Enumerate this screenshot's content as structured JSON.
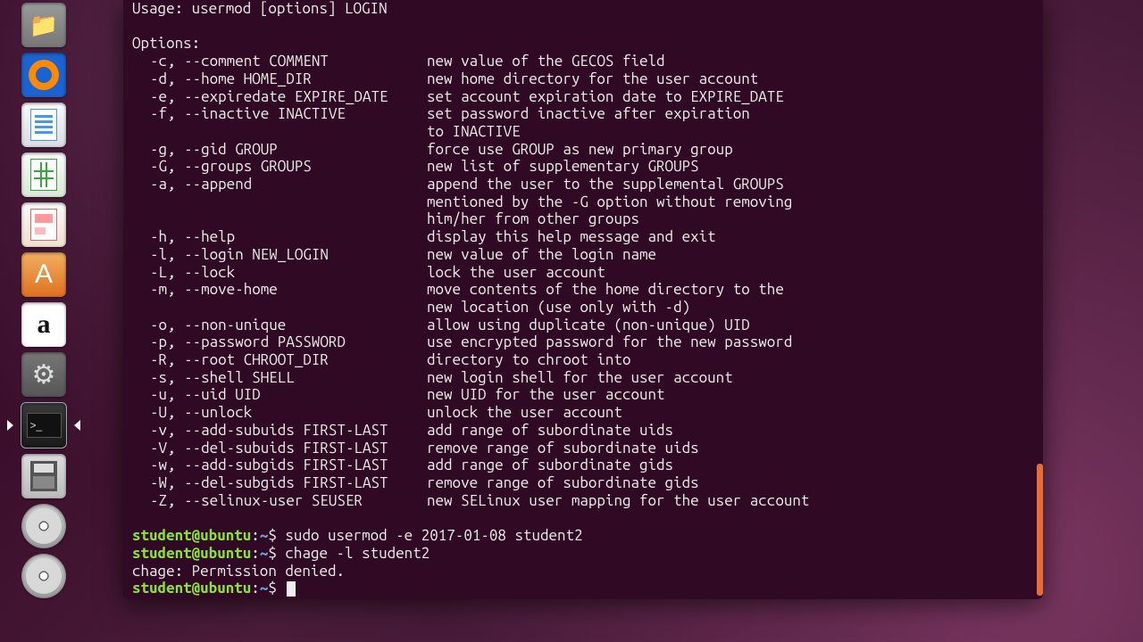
{
  "launcher": {
    "items": [
      {
        "name": "files-icon"
      },
      {
        "name": "firefox-icon"
      },
      {
        "name": "writer-icon"
      },
      {
        "name": "calc-icon"
      },
      {
        "name": "impress-icon"
      },
      {
        "name": "software-center-icon"
      },
      {
        "name": "amazon-icon",
        "glyph": "a"
      },
      {
        "name": "settings-icon",
        "glyph": "⚙"
      },
      {
        "name": "terminal-icon",
        "glyph": ">_",
        "active": true
      },
      {
        "name": "disk-icon"
      },
      {
        "name": "dvd1-icon"
      },
      {
        "name": "dvd2-icon"
      }
    ]
  },
  "terminal": {
    "usage": "Usage: usermod [options] LOGIN",
    "options_header": "Options:",
    "options": [
      {
        "flags": "-c, --comment COMMENT",
        "desc": "new value of the GECOS field"
      },
      {
        "flags": "-d, --home HOME_DIR",
        "desc": "new home directory for the user account"
      },
      {
        "flags": "-e, --expiredate EXPIRE_DATE",
        "desc": "set account expiration date to EXPIRE_DATE"
      },
      {
        "flags": "-f, --inactive INACTIVE",
        "desc": "set password inactive after expiration"
      },
      {
        "flags": "",
        "desc": "to INACTIVE"
      },
      {
        "flags": "-g, --gid GROUP",
        "desc": "force use GROUP as new primary group"
      },
      {
        "flags": "-G, --groups GROUPS",
        "desc": "new list of supplementary GROUPS"
      },
      {
        "flags": "-a, --append",
        "desc": "append the user to the supplemental GROUPS"
      },
      {
        "flags": "",
        "desc": "mentioned by the -G option without removing"
      },
      {
        "flags": "",
        "desc": "him/her from other groups"
      },
      {
        "flags": "-h, --help",
        "desc": "display this help message and exit"
      },
      {
        "flags": "-l, --login NEW_LOGIN",
        "desc": "new value of the login name"
      },
      {
        "flags": "-L, --lock",
        "desc": "lock the user account"
      },
      {
        "flags": "-m, --move-home",
        "desc": "move contents of the home directory to the"
      },
      {
        "flags": "",
        "desc": "new location (use only with -d)"
      },
      {
        "flags": "-o, --non-unique",
        "desc": "allow using duplicate (non-unique) UID"
      },
      {
        "flags": "-p, --password PASSWORD",
        "desc": "use encrypted password for the new password"
      },
      {
        "flags": "-R, --root CHROOT_DIR",
        "desc": "directory to chroot into"
      },
      {
        "flags": "-s, --shell SHELL",
        "desc": "new login shell for the user account"
      },
      {
        "flags": "-u, --uid UID",
        "desc": "new UID for the user account"
      },
      {
        "flags": "-U, --unlock",
        "desc": "unlock the user account"
      },
      {
        "flags": "-v, --add-subuids FIRST-LAST",
        "desc": "add range of subordinate uids"
      },
      {
        "flags": "-V, --del-subuids FIRST-LAST",
        "desc": "remove range of subordinate uids"
      },
      {
        "flags": "-w, --add-subgids FIRST-LAST",
        "desc": "add range of subordinate gids"
      },
      {
        "flags": "-W, --del-subgids FIRST-LAST",
        "desc": "remove range of subordinate gids"
      },
      {
        "flags": "-Z, --selinux-user SEUSER",
        "desc": "new SELinux user mapping for the user account"
      }
    ],
    "prompt": {
      "userhost": "student@ubuntu",
      "sep": ":",
      "path": "~",
      "sym": "$"
    },
    "history": [
      {
        "cmd": "sudo usermod -e 2017-01-08 student2"
      },
      {
        "cmd": "chage -l student2"
      }
    ],
    "output_line": "chage: Permission denied.",
    "current_cmd": ""
  }
}
